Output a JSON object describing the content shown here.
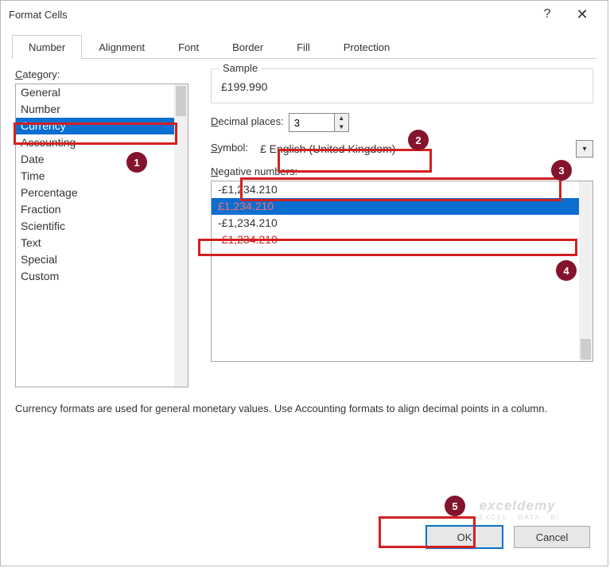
{
  "title": "Format Cells",
  "titlebar": {
    "help": "?",
    "close": "✕"
  },
  "tabs": [
    "Number",
    "Alignment",
    "Font",
    "Border",
    "Fill",
    "Protection"
  ],
  "active_tab": 0,
  "category": {
    "label": "Category:",
    "items": [
      "General",
      "Number",
      "Currency",
      "Accounting",
      "Date",
      "Time",
      "Percentage",
      "Fraction",
      "Scientific",
      "Text",
      "Special",
      "Custom"
    ],
    "selected_index": 2
  },
  "sample": {
    "legend": "Sample",
    "value": "£199.990"
  },
  "decimal": {
    "label": "Decimal places:",
    "value": "3"
  },
  "symbol": {
    "label": "Symbol:",
    "value": "£ English (United Kingdom)"
  },
  "negative": {
    "label": "Negative numbers:",
    "items": [
      {
        "text": "-£1,234.210",
        "red": false
      },
      {
        "text": "£1,234.210",
        "red": true
      },
      {
        "text": "-£1,234.210",
        "red": false
      },
      {
        "text": "-£1,234.210",
        "red": true
      }
    ],
    "selected_index": 1
  },
  "description": "Currency formats are used for general monetary values.  Use Accounting formats to align decimal points in a column.",
  "buttons": {
    "ok": "OK",
    "cancel": "Cancel"
  },
  "badges": [
    "1",
    "2",
    "3",
    "4",
    "5"
  ],
  "watermark": {
    "brand": "exceldemy",
    "tag": "EXCEL · DATA · BI"
  }
}
